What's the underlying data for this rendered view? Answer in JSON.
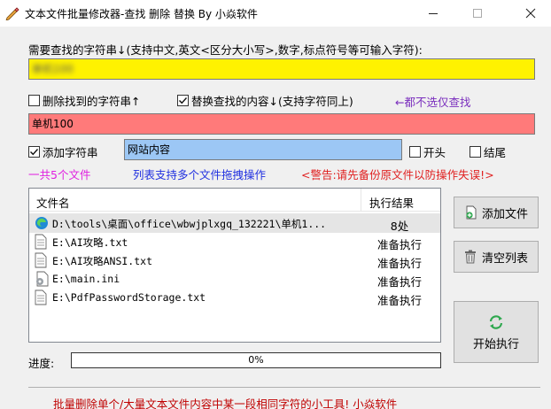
{
  "window": {
    "title": "文本文件批量修改器-查找 删除 替换 By 小焱软件"
  },
  "search": {
    "label": "需要查找的字符串↓(支持中文,英文<区分大小写>,数字,标点符号等可输入字符):",
    "value": "单机100",
    "bg_color": "#fff200"
  },
  "options": {
    "delete_label": "删除找到的字符串↑",
    "delete_checked": false,
    "replace_label": "替换查找的内容↓(支持字符同上)",
    "replace_checked": true,
    "hint": "←都不选仅查找",
    "hint_color": "#7b2fbe"
  },
  "replace": {
    "value": "单机100",
    "bg_color": "#ff7a7a"
  },
  "add": {
    "label": "添加字符串",
    "checked": true,
    "value": "网站内容",
    "bg_color": "#9cc7f5",
    "start_label": "开头",
    "start_checked": false,
    "end_label": "结尾",
    "end_checked": false
  },
  "info": {
    "count_text": "一共5个文件",
    "count_color": "#e020e0",
    "drag_text": "列表支持多个文件拖拽操作",
    "drag_color": "#2030e0",
    "warning_text": "<警告:请先备份原文件以防操作失误!>",
    "warning_color": "#e02020"
  },
  "list": {
    "col_name": "文件名",
    "col_result": "执行结果",
    "rows": [
      {
        "path": "D:\\tools\\桌面\\office\\wbwjplxgq_132221\\单机1...",
        "result": "8处",
        "icon": "edge-icon"
      },
      {
        "path": "E:\\AI攻略.txt",
        "result": "准备执行",
        "icon": "text-file-icon"
      },
      {
        "path": "E:\\AI攻略ANSI.txt",
        "result": "准备执行",
        "icon": "text-file-icon"
      },
      {
        "path": "E:\\main.ini",
        "result": "准备执行",
        "icon": "settings-file-icon"
      },
      {
        "path": "E:\\PdfPasswordStorage.txt",
        "result": "准备执行",
        "icon": "text-file-icon"
      }
    ]
  },
  "buttons": {
    "add_file": "添加文件",
    "clear_list": "清空列表",
    "start": "开始执行"
  },
  "progress": {
    "label": "进度:",
    "value": 0,
    "text": "0%"
  },
  "footer": {
    "text": "批量删除单个/大量文本文件内容中某一段相同字符的小工具! 小焱软件",
    "color": "#c00000"
  }
}
